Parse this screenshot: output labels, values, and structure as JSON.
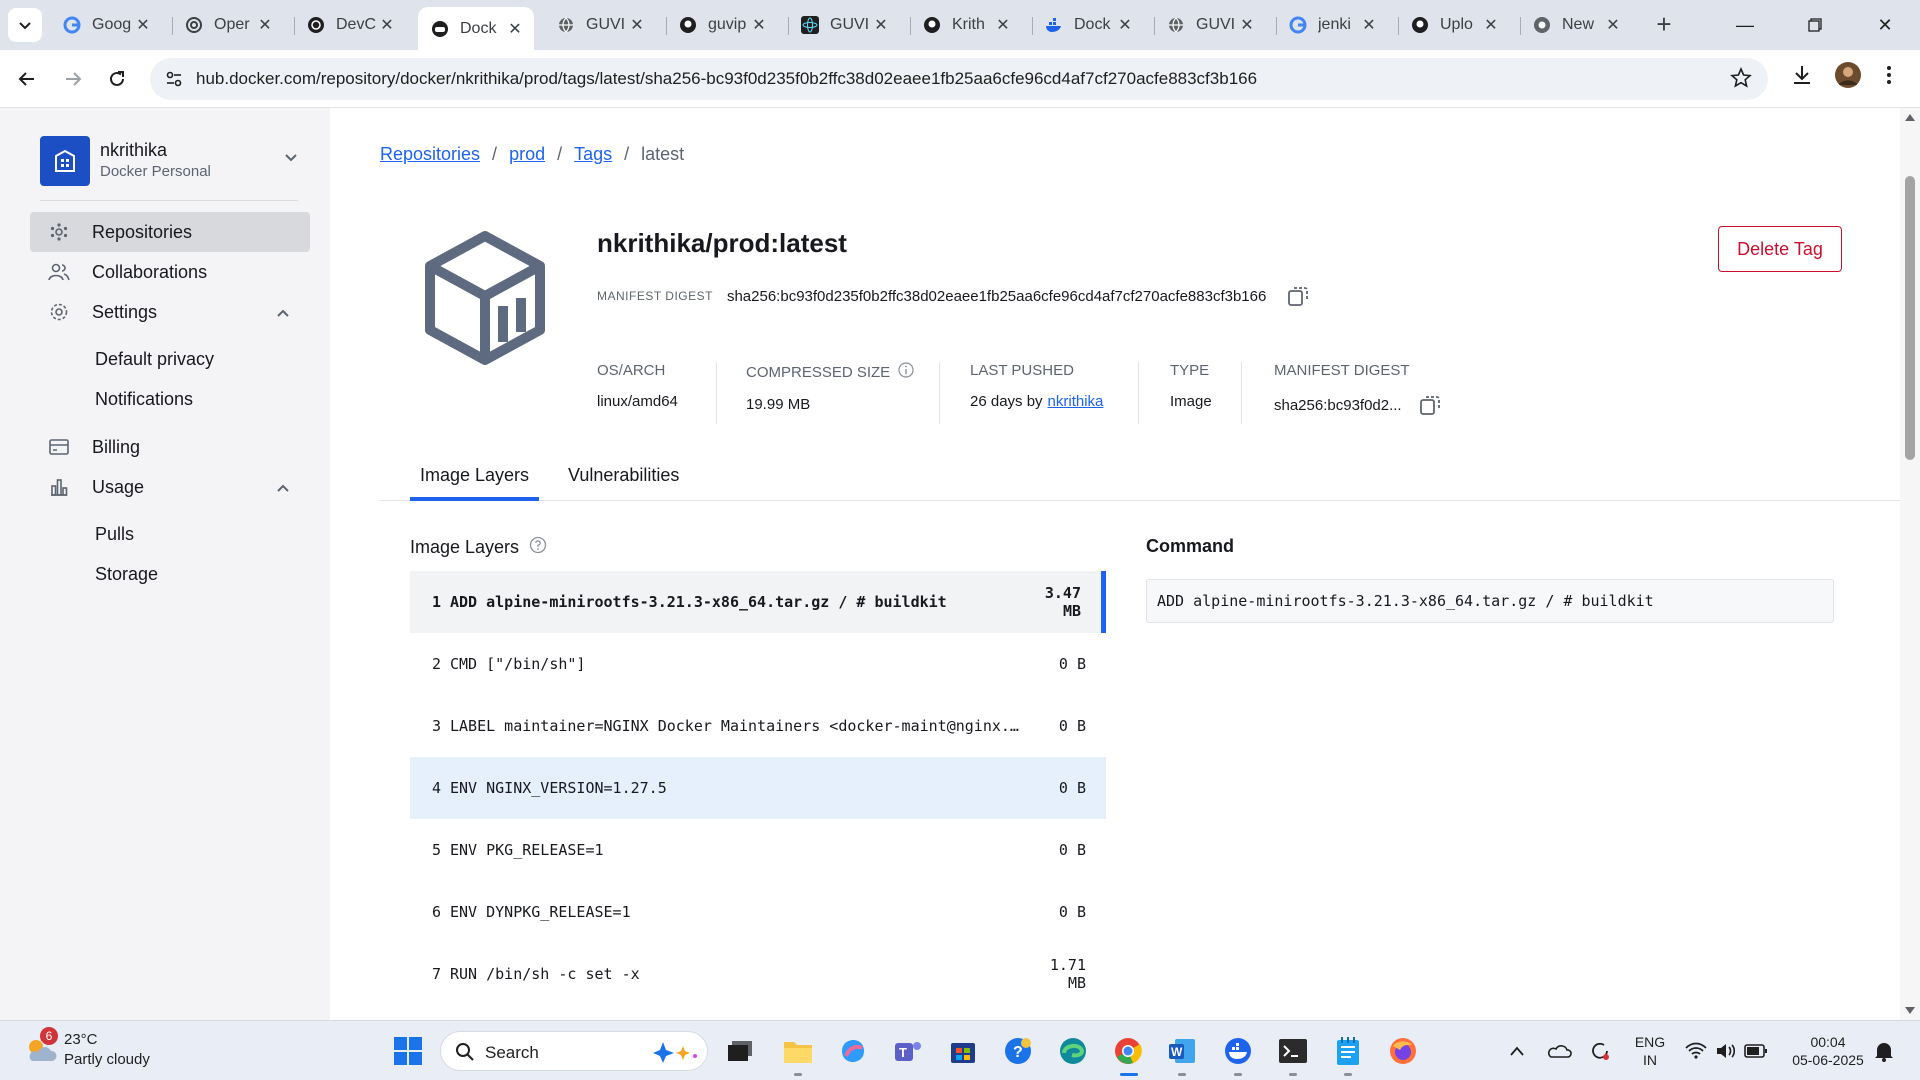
{
  "browser": {
    "tabs": [
      {
        "label": "Goog",
        "icon": "google-icon"
      },
      {
        "label": "Oper",
        "icon": "openai-icon"
      },
      {
        "label": "DevC",
        "icon": "openai-icon"
      },
      {
        "label": "Dock",
        "icon": "docker-icon",
        "active": true
      },
      {
        "label": "GUVI",
        "icon": "globe-icon"
      },
      {
        "label": "guvip",
        "icon": "github-icon"
      },
      {
        "label": "GUVI",
        "icon": "react-icon"
      },
      {
        "label": "Krith",
        "icon": "github-icon"
      },
      {
        "label": "Dock",
        "icon": "docker-icon"
      },
      {
        "label": "GUVI",
        "icon": "globe-icon"
      },
      {
        "label": "jenki",
        "icon": "google-icon"
      },
      {
        "label": "Uplo",
        "icon": "github-icon"
      },
      {
        "label": "New",
        "icon": "chrome-icon"
      }
    ],
    "url": "hub.docker.com/repository/docker/nkrithika/prod/tags/latest/sha256-bc93f0d235f0b2ffc38d02eaee1fb25aa6cfe96cd4af7cf270acfe883cf3b166"
  },
  "sidebar": {
    "org_name": "nkrithika",
    "org_type": "Docker Personal",
    "items": [
      {
        "label": "Repositories"
      },
      {
        "label": "Collaborations"
      },
      {
        "label": "Settings"
      },
      {
        "label": "Billing"
      },
      {
        "label": "Usage"
      }
    ],
    "settings_sub": [
      "Default privacy",
      "Notifications"
    ],
    "usage_sub": [
      "Pulls",
      "Storage"
    ]
  },
  "breadcrumb": {
    "repositories": "Repositories",
    "prod": "prod",
    "tags": "Tags",
    "current": "latest",
    "sep": "/"
  },
  "image": {
    "title": "nkrithika/prod:latest",
    "manifest_digest_label": "MANIFEST DIGEST",
    "manifest_digest": "sha256:bc93f0d235f0b2ffc38d02eaee1fb25aa6cfe96cd4af7cf270acfe883cf3b166",
    "delete_label": "Delete Tag"
  },
  "meta": {
    "os_arch_label": "OS/ARCH",
    "os_arch": "linux/amd64",
    "size_label": "COMPRESSED SIZE",
    "size": "19.99 MB",
    "pushed_label": "LAST PUSHED",
    "pushed_prefix": "26 days by",
    "pushed_user": "nkrithika",
    "type_label": "TYPE",
    "type": "Image",
    "digest_label": "MANIFEST DIGEST",
    "digest_short": "sha256:bc93f0d2..."
  },
  "tabs": {
    "layers": "Image Layers",
    "vulns": "Vulnerabilities"
  },
  "layers": {
    "heading": "Image Layers",
    "command_heading": "Command",
    "rows": [
      {
        "num": "1",
        "cmd": "ADD alpine-minirootfs-3.21.3-x86_64.tar.gz / # buildkit",
        "size": "3.47 MB"
      },
      {
        "num": "2",
        "cmd": "CMD [\"/bin/sh\"]",
        "size": "0 B"
      },
      {
        "num": "3",
        "cmd": "LABEL maintainer=NGINX Docker Maintainers <docker-maint@nginx.com>",
        "size": "0 B"
      },
      {
        "num": "4",
        "cmd": "ENV NGINX_VERSION=1.27.5",
        "size": "0 B"
      },
      {
        "num": "5",
        "cmd": "ENV PKG_RELEASE=1",
        "size": "0 B"
      },
      {
        "num": "6",
        "cmd": "ENV DYNPKG_RELEASE=1",
        "size": "0 B"
      },
      {
        "num": "7",
        "cmd": "RUN /bin/sh -c set -x",
        "size": "1.71 MB"
      }
    ],
    "selected_command": "ADD alpine-minirootfs-3.21.3-x86_64.tar.gz / # buildkit"
  },
  "taskbar": {
    "weather_temp": "23°C",
    "weather_cond": "Partly cloudy",
    "weather_badge": "6",
    "search_label": "Search",
    "lang_1": "ENG",
    "lang_2": "IN",
    "time": "00:04",
    "date": "05-06-2025"
  },
  "colors": {
    "accent": "#1d63ed",
    "delete": "#c8102e",
    "sidebar_bg": "#f4f4f6",
    "selected_row": "#f2f3f5",
    "hover_row": "#e5f0fc"
  }
}
